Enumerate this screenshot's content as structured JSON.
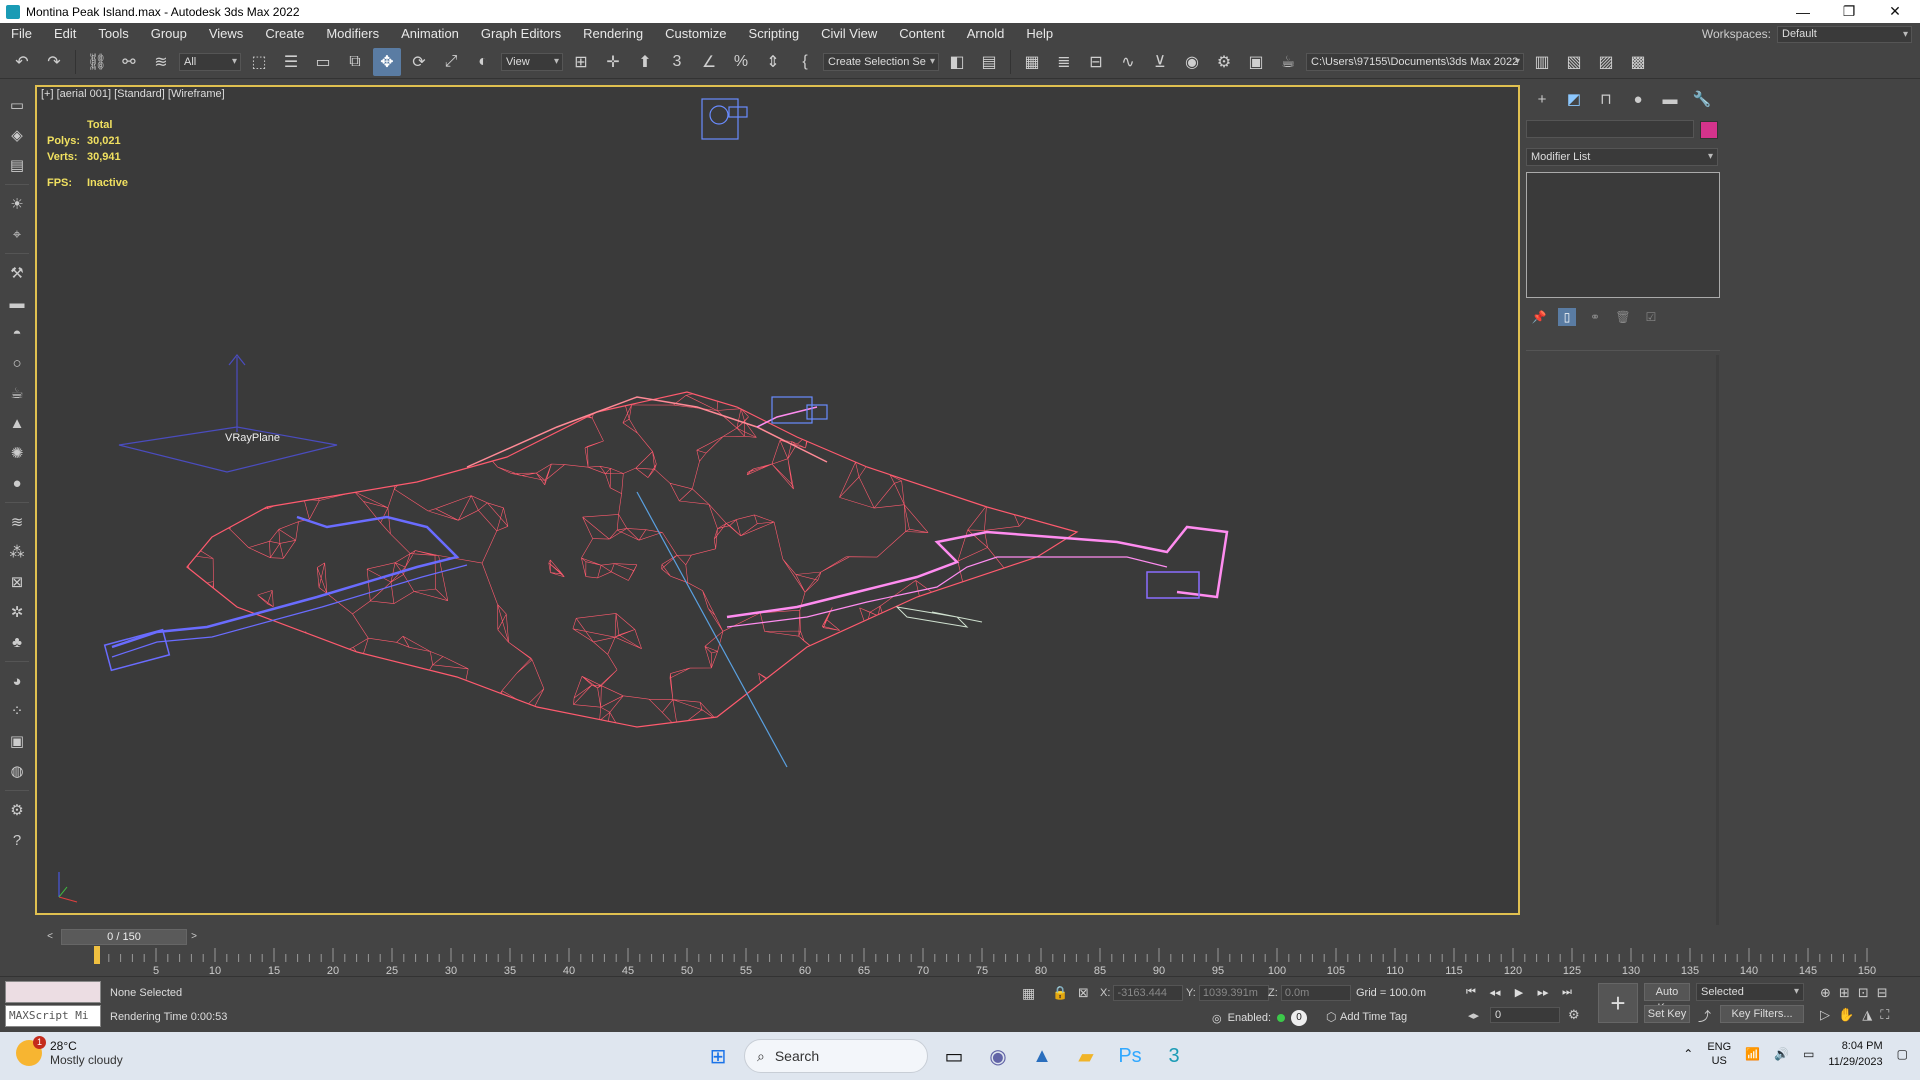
{
  "window": {
    "title": "Montina Peak Island.max - Autodesk 3ds Max 2022",
    "controls": {
      "minimize": "—",
      "maximize": "❐",
      "close": "✕"
    }
  },
  "menu": [
    "File",
    "Edit",
    "Tools",
    "Group",
    "Views",
    "Create",
    "Modifiers",
    "Animation",
    "Graph Editors",
    "Rendering",
    "Customize",
    "Scripting",
    "Civil View",
    "Content",
    "Arnold",
    "Help"
  ],
  "workspace": {
    "label": "Workspaces:",
    "value": "Default"
  },
  "toolbar": {
    "filter": "All",
    "refcoord": "View",
    "named_selection": "Create Selection Se",
    "project_path": "C:\\Users\\97155\\Documents\\3ds Max 2022"
  },
  "viewport": {
    "label": "[+] [aerial 001] [Standard] [Wireframe]",
    "stats": {
      "header": "Total",
      "polys_label": "Polys:",
      "polys": "30,021",
      "verts_label": "Verts:",
      "verts": "30,941",
      "fps_label": "FPS:",
      "fps": "Inactive"
    },
    "object_label": "VRayPlane"
  },
  "command_panel": {
    "modifier_list": "Modifier List",
    "object_color": "#d5338c"
  },
  "time": {
    "frame_display": "0 / 150",
    "start": 0,
    "end": 150,
    "current": 0,
    "prev": "<",
    "next": ">"
  },
  "status": {
    "maxscript": "MAXScript Mi",
    "selection": "None Selected",
    "rendering_time": "Rendering Time  0:00:53",
    "x_label": "X:",
    "x": "-3163.444",
    "y_label": "Y:",
    "y": "1039.391m",
    "z_label": "Z:",
    "z": "0.0m",
    "grid": "Grid = 100.0m",
    "enabled": "Enabled:",
    "enabled_value": "0",
    "add_time_tag": "Add Time Tag",
    "frame_value": "0",
    "auto_key": "Auto Key",
    "set_key": "Set Key",
    "key_mode": "Selected",
    "key_filters": "Key Filters..."
  },
  "taskbar": {
    "weather_badge": "1",
    "temperature": "28°C",
    "weather": "Mostly cloudy",
    "search": "Search",
    "lang1": "ENG",
    "lang2": "US",
    "time": "8:04 PM",
    "date": "11/29/2023"
  },
  "colors": {
    "mesh": "#ff5a6e",
    "path_blue": "#6a6cff",
    "path_pink": "#ff8cf0",
    "selection": "#e0c050"
  }
}
